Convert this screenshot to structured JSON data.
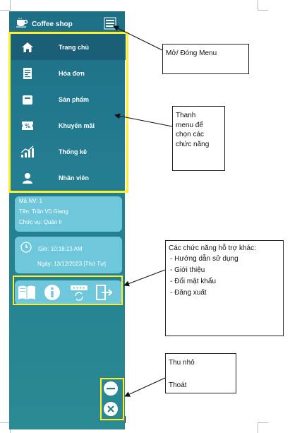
{
  "app": {
    "title": "Coffee shop"
  },
  "menu": {
    "items": [
      {
        "label": "Trang chủ",
        "icon": "home-icon"
      },
      {
        "label": "Hóa đơn",
        "icon": "invoice-icon"
      },
      {
        "label": "Sản phẩm",
        "icon": "product-icon"
      },
      {
        "label": "Khuyến mãi",
        "icon": "discount-icon"
      },
      {
        "label": "Thống kê",
        "icon": "stats-icon"
      },
      {
        "label": "Nhân viên",
        "icon": "user-icon"
      }
    ]
  },
  "employee": {
    "id_line": "Mã NV: 1",
    "name_line": "Tên: Trần Vũ Giang",
    "role_line": "Chức vụ: Quản lí"
  },
  "clock": {
    "time_line": "Giờ: 10:18:23 AM",
    "date_line": "Ngày: 13/12/2023 [Thứ Tư]"
  },
  "tools": [
    "book-icon",
    "info-icon",
    "password-refresh-icon",
    "logout-icon"
  ],
  "annotations": {
    "menu_toggle": "Mở/ Đóng Menu",
    "menu_bar": "Thanh\nmenu để\nchọn các\nchức năng",
    "support_title": "Các chức năng hỗ trợ khác:",
    "support_items": [
      "- Hướng dẫn sử dụng",
      "- Giới thiệu",
      "- Đổi mật khẩu",
      "- Đăng xuất"
    ],
    "minimize": "Thu nhỏ",
    "exit": "Thoát"
  },
  "colors": {
    "sidebar": "#237c90",
    "active_item": "#1a5e78",
    "card": "#6fc7dc",
    "highlight": "#ffef2a"
  }
}
